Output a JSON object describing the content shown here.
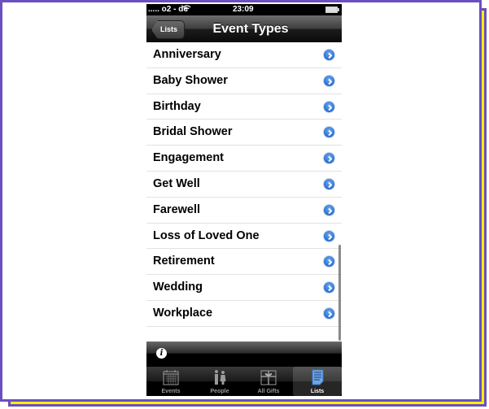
{
  "status_bar": {
    "carrier": "..... o2 - de",
    "wifi_icon": "wifi-icon",
    "time": "23:09",
    "battery_icon": "battery-icon"
  },
  "nav_bar": {
    "back_label": "Lists",
    "title": "Event Types"
  },
  "event_types": [
    {
      "label": "Anniversary"
    },
    {
      "label": "Baby Shower"
    },
    {
      "label": "Birthday"
    },
    {
      "label": "Bridal Shower"
    },
    {
      "label": "Engagement"
    },
    {
      "label": "Get Well"
    },
    {
      "label": "Farewell"
    },
    {
      "label": "Loss of Loved One"
    },
    {
      "label": "Retirement"
    },
    {
      "label": "Wedding"
    },
    {
      "label": "Workplace"
    }
  ],
  "toolbar": {
    "info_glyph": "i"
  },
  "tab_bar": {
    "tabs": [
      {
        "label": "Events",
        "icon": "calendar-icon",
        "active": false
      },
      {
        "label": "People",
        "icon": "people-icon",
        "active": false
      },
      {
        "label": "All Gifts",
        "icon": "gift-icon",
        "active": false
      },
      {
        "label": "Lists",
        "icon": "list-icon",
        "active": true
      }
    ]
  },
  "colors": {
    "frame_border": "#6a4fc0",
    "frame_shadow": "#ffee00",
    "disclosure_blue": "#2a6fd0"
  }
}
